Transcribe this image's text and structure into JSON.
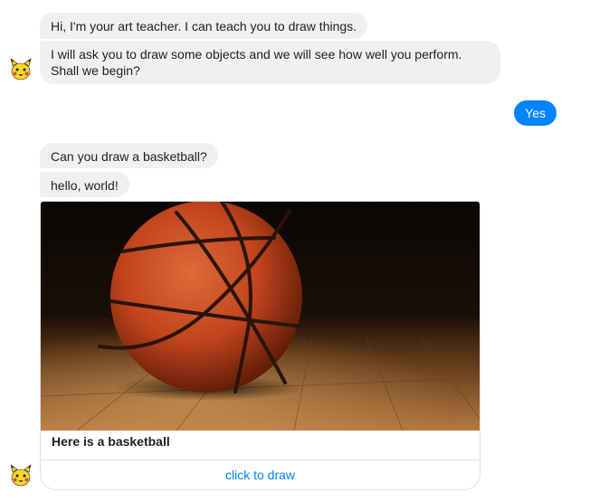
{
  "bot": {
    "avatar_icon": "pikachu-face-icon",
    "messages": [
      "Hi, I'm your art teacher. I can teach you to draw things.",
      "I will ask you to draw some objects and we will see how well you perform. Shall we begin?"
    ]
  },
  "user": {
    "reply": "Yes"
  },
  "prompt": {
    "messages": [
      "Can you draw a basketball?",
      "hello, world!"
    ]
  },
  "card": {
    "image_subject": "basketball on wooden court",
    "title": "Here is a basketball",
    "button_label": "click to draw"
  },
  "colors": {
    "bot_bubble": "#f1f0f0",
    "user_bubble": "#0084ff",
    "link": "#0084ff"
  }
}
